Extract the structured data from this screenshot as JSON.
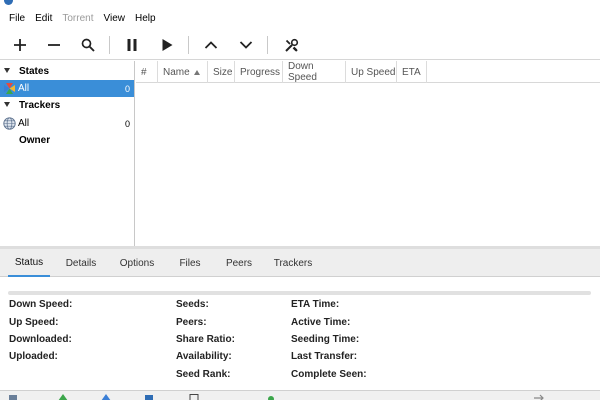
{
  "menubar": {
    "items": [
      {
        "label": "File",
        "enabled": true
      },
      {
        "label": "Edit",
        "enabled": true
      },
      {
        "label": "Torrent",
        "enabled": false
      },
      {
        "label": "View",
        "enabled": true
      },
      {
        "label": "Help",
        "enabled": true
      }
    ]
  },
  "toolbar": {
    "buttons": [
      "add-icon",
      "remove-icon",
      "search-icon",
      "pause-icon",
      "resume-icon",
      "move-up-icon",
      "move-down-icon",
      "preferences-icon"
    ]
  },
  "sidebar": {
    "states": {
      "label": "States",
      "items": [
        {
          "label": "All",
          "count": "0",
          "selected": true
        }
      ]
    },
    "trackers": {
      "label": "Trackers",
      "items": [
        {
          "label": "All",
          "count": "0"
        }
      ]
    },
    "owner": {
      "label": "Owner"
    }
  },
  "torrent_list": {
    "columns": [
      {
        "label": "#"
      },
      {
        "label": "Name",
        "sorted": "ascending"
      },
      {
        "label": "Size"
      },
      {
        "label": "Progress"
      },
      {
        "label": "Down Speed"
      },
      {
        "label": "Up Speed"
      },
      {
        "label": "ETA"
      }
    ]
  },
  "details": {
    "tabs": [
      {
        "label": "Status",
        "active": true
      },
      {
        "label": "Details"
      },
      {
        "label": "Options"
      },
      {
        "label": "Files"
      },
      {
        "label": "Peers"
      },
      {
        "label": "Trackers"
      }
    ],
    "progress": 0,
    "fields": {
      "down_speed": "Down Speed:",
      "up_speed": "Up Speed:",
      "downloaded": "Downloaded:",
      "uploaded": "Uploaded:",
      "seeds": "Seeds:",
      "peers": "Peers:",
      "share_ratio": "Share Ratio:",
      "availability": "Availability:",
      "seed_rank": "Seed Rank:",
      "eta_time": "ETA Time:",
      "active_time": "Active Time:",
      "seeding_time": "Seeding Time:",
      "last_transfer": "Last Transfer:",
      "complete_seen": "Complete Seen:"
    }
  },
  "colors": {
    "accent": "#3a8ed8",
    "tab_bar": "#eeeeee",
    "disabled_text": "#9a9a9a"
  }
}
